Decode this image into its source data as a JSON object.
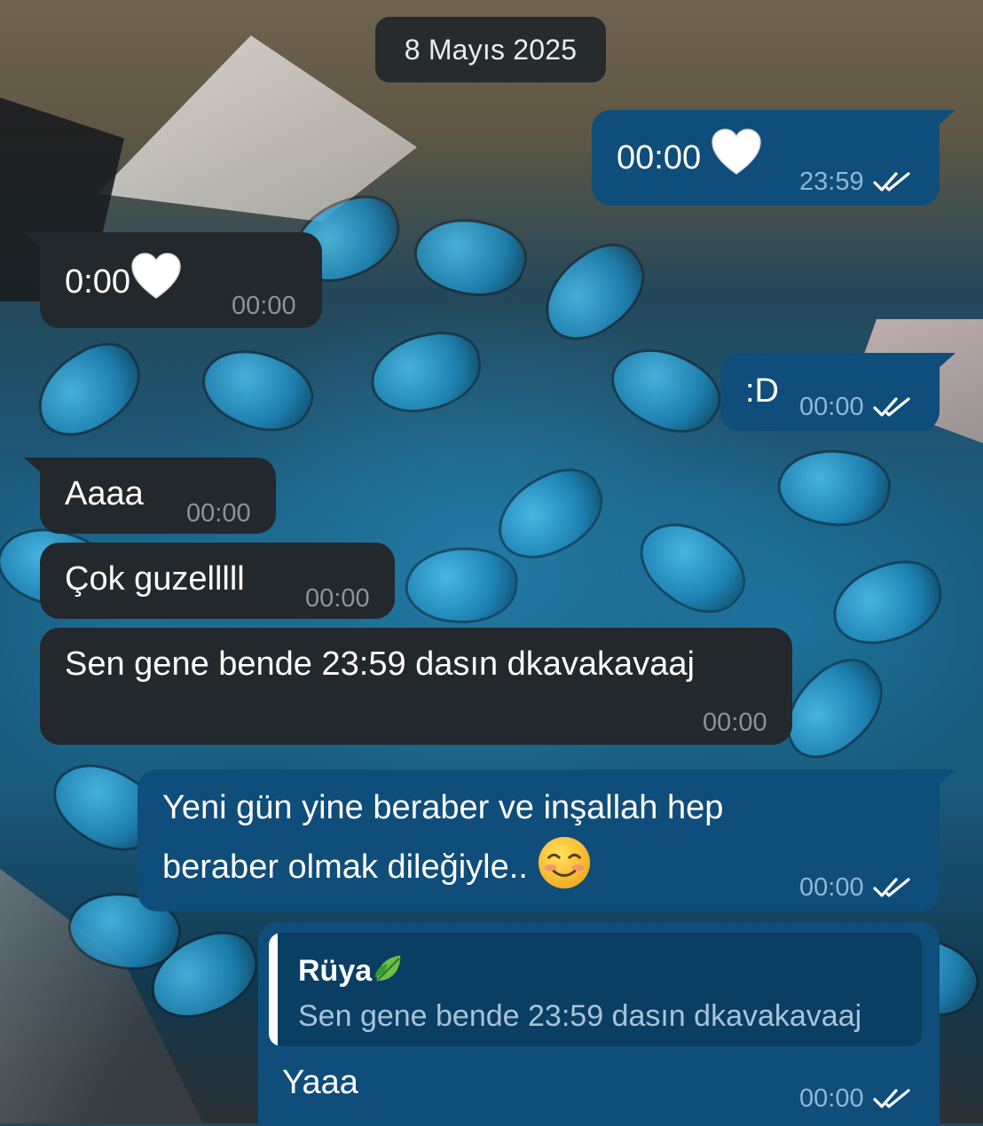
{
  "date_separator": "8 Mayıs 2025",
  "colors": {
    "outgoing_bubble": "#0f4d7a",
    "incoming_bubble": "#22282c",
    "outgoing_meta": "#8fb8d6",
    "incoming_meta": "#8b9498",
    "read_ticks": "#ffffff"
  },
  "messages": [
    {
      "direction": "outgoing",
      "text": "00:00",
      "emoji": "white-heart-icon",
      "time": "23:59",
      "status": "read"
    },
    {
      "direction": "incoming",
      "text": "0:00",
      "emoji": "white-heart-icon",
      "time": "00:00"
    },
    {
      "direction": "outgoing",
      "text": ":D",
      "time": "00:00",
      "status": "read"
    },
    {
      "direction": "incoming",
      "text": "Aaaa",
      "time": "00:00"
    },
    {
      "direction": "incoming",
      "text": "Çok guzelllll",
      "time": "00:00"
    },
    {
      "direction": "incoming",
      "text": "Sen gene bende 23:59 dasın dkavakavaaj",
      "time": "00:00"
    },
    {
      "direction": "outgoing",
      "line1": "Yeni gün yine beraber ve inşallah hep",
      "line2": "beraber olmak dileğiyle..",
      "emoji": "smiling-face-icon",
      "time": "00:00",
      "status": "read"
    },
    {
      "direction": "outgoing",
      "reply_to": {
        "author": "Rüya",
        "author_emoji": "leaf-icon",
        "text": "Sen gene bende 23:59 dasın dkavakavaaj"
      },
      "text": "Yaaa",
      "time": "00:00",
      "status": "read"
    }
  ]
}
